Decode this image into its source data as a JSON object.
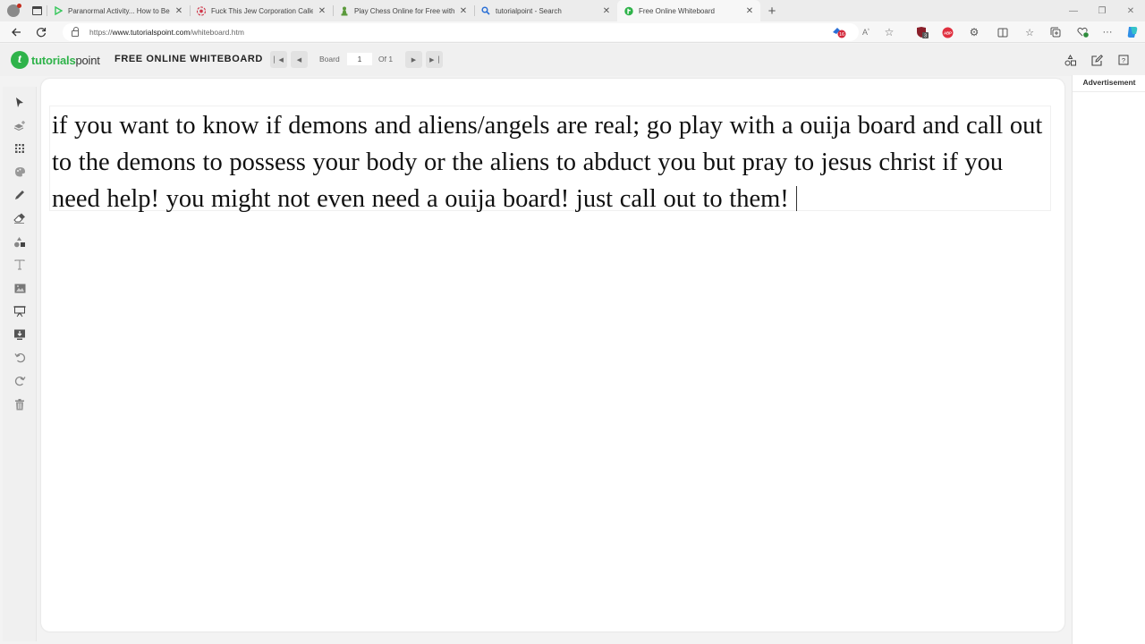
{
  "browser": {
    "tabs": [
      {
        "title": "Paranormal Activity... How to Beat",
        "icon": "video-icon",
        "icon_color": "#35c75a",
        "active": false
      },
      {
        "title": "Fuck This Jew Corporation Called",
        "icon": "site-icon",
        "icon_color": "#d0374a",
        "active": false
      },
      {
        "title": "Play Chess Online for Free with Fr",
        "icon": "chess-pawn-icon",
        "icon_color": "#5b9a3c",
        "active": false
      },
      {
        "title": "tutorialpoint - Search",
        "icon": "search-icon",
        "icon_color": "#2a6fd6",
        "active": false
      },
      {
        "title": "Free Online Whiteboard",
        "icon": "tutorialspoint-icon",
        "icon_color": "#2fb34a",
        "active": true
      }
    ],
    "new_tab_label": "+",
    "url_prefix": "https://",
    "url_domain": "www.tutorialspoint.com",
    "url_path": "/whiteboard.htm",
    "extension_badges": {
      "ext1": "16",
      "ext2": "3",
      "adblock": "ABP"
    }
  },
  "header": {
    "logo_part1": "tutorials",
    "logo_part2": "point",
    "title": "FREE ONLINE WHITEBOARD",
    "board_label": "Board",
    "board_value": "1",
    "of_label": "Of 1"
  },
  "canvas": {
    "text": "if you want to know if demons and aliens/angels are real; go play with a ouija board and call out to the demons to possess your body or the aliens to abduct you but pray to jesus christ if you need help! you might not even need a ouija board! just call out to them!"
  },
  "ad": {
    "label": "Advertisement"
  },
  "colors": {
    "brand_green": "#2fb34a",
    "toolbar_bg": "#f0f0f0",
    "icon_gray": "#555555"
  }
}
